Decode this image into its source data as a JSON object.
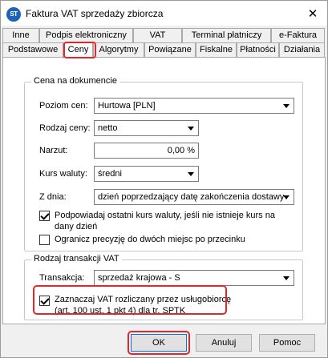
{
  "window": {
    "title": "Faktura VAT sprzedaży zbiorcza",
    "app_icon_text": "ST",
    "close_glyph": "✕"
  },
  "tabs": {
    "row1": [
      "Inne",
      "Podpis elektroniczny",
      "VAT",
      "Terminal płatniczy",
      "e-Faktura"
    ],
    "row2": [
      "Podstawowe",
      "Ceny",
      "Algorytmy",
      "Powiązane",
      "Fiskalne",
      "Płatności",
      "Działania"
    ],
    "active": "Ceny"
  },
  "price_group": {
    "title": "Cena na dokumencie",
    "price_level_label": "Poziom cen:",
    "price_level_value": "Hurtowa [PLN]",
    "price_type_label": "Rodzaj ceny:",
    "price_type_value": "netto",
    "markup_label": "Narzut:",
    "markup_value": "0,00 %",
    "fx_rate_label": "Kurs waluty:",
    "fx_rate_value": "średni",
    "date_label": "Z dnia:",
    "date_value": "dzień poprzedzający datę zakończenia dostawy",
    "suggest_rate_checkbox": {
      "checked": true,
      "label_line1": "Podpowiadaj ostatni kurs waluty, jeśli nie istnieje kurs na",
      "label_line2": "dany dzień"
    },
    "limit_precision_checkbox": {
      "checked": false,
      "label": "Ogranicz precyzję do dwóch miejsc po przecinku"
    }
  },
  "vat_group": {
    "title": "Rodzaj transakcji VAT",
    "transaction_label": "Transakcja:",
    "transaction_value": "sprzedaż krajowa - S",
    "mark_vat_checkbox": {
      "checked": true,
      "label_line1": "Zaznaczaj VAT rozliczany przez usługobiorcę",
      "label_line2": "(art. 100 ust. 1 pkt 4) dla tr. SPTK"
    }
  },
  "buttons": {
    "ok": "OK",
    "cancel": "Anuluj",
    "help": "Pomoc"
  },
  "highlight_color": "#e0282c"
}
